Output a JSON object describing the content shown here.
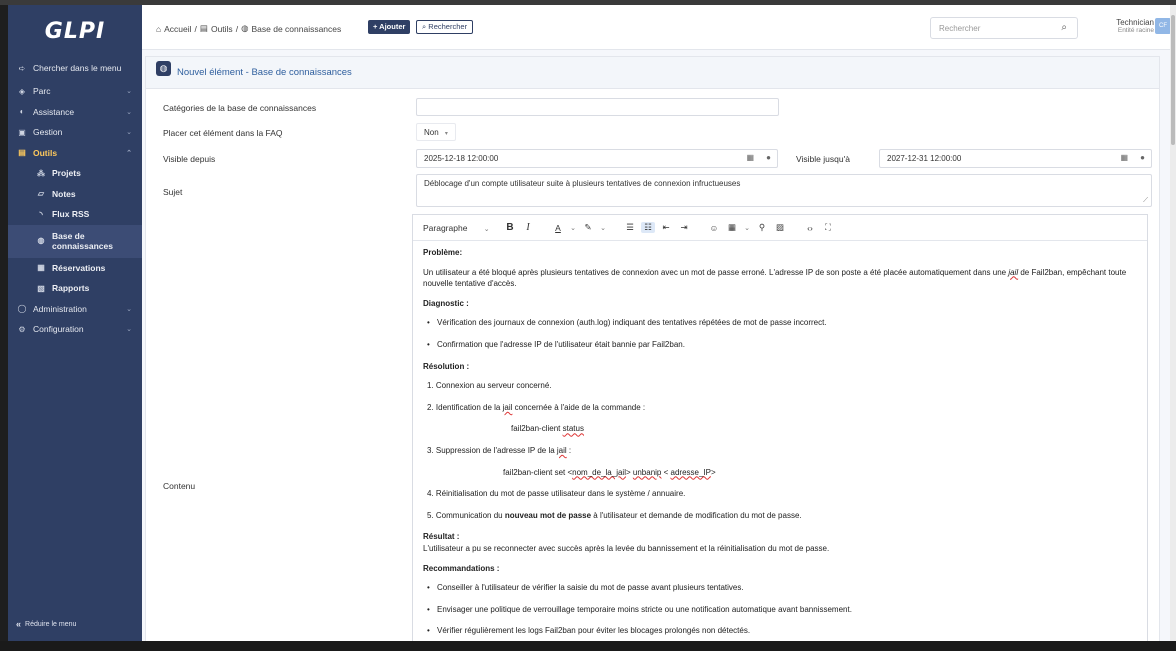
{
  "app": {
    "logo": "GLPI"
  },
  "sidebar": {
    "search_label": "Chercher dans le menu",
    "items": [
      {
        "label": "Parc",
        "icon": "cube-icon"
      },
      {
        "label": "Assistance",
        "icon": "headset-icon"
      },
      {
        "label": "Gestion",
        "icon": "wallet-icon"
      },
      {
        "label": "Outils",
        "icon": "briefcase-icon"
      },
      {
        "label": "Administration",
        "icon": "shield-icon"
      },
      {
        "label": "Configuration",
        "icon": "gear-icon"
      }
    ],
    "sub_items": [
      {
        "label": "Projets"
      },
      {
        "label": "Notes"
      },
      {
        "label": "Flux RSS"
      },
      {
        "label": "Base de connaissances"
      },
      {
        "label": "Réservations"
      },
      {
        "label": "Rapports"
      }
    ],
    "collapse_label": "Réduire le menu"
  },
  "header": {
    "breadcrumb": [
      "Accueil",
      "Outils",
      "Base de connaissances"
    ],
    "add_label": "+ Ajouter",
    "search_label": "Rechercher",
    "global_search_placeholder": "Rechercher",
    "user_name": "Technician",
    "user_entity": "Entité racine",
    "avatar_initials": "CF"
  },
  "form": {
    "title": "Nouvel élément - Base de connaissances",
    "categories_label": "Catégories de la base de connaissances",
    "categories_value": "",
    "faq_label": "Placer cet élément dans la FAQ",
    "faq_value": "Non",
    "visible_from_label": "Visible depuis",
    "visible_from_value": "2025-12-18 12:00:00",
    "visible_until_label": "Visible jusqu'à",
    "visible_until_value": "2027-12-31 12:00:00",
    "subject_label": "Sujet",
    "subject_value": "Déblocage d'un compte utilisateur suite à plusieurs tentatives de connexion infructueuses",
    "content_label": "Contenu"
  },
  "editor": {
    "block_format": "Paragraphe",
    "content": {
      "h_probleme": "Problème:",
      "p_probleme_a": "Un utilisateur a été bloqué après plusieurs tentatives de connexion avec un mot de passe erroné. L'adresse IP de son poste a été placée automatiquement dans une ",
      "p_probleme_jail": "jail",
      "p_probleme_b": " de Fail2ban, empêchant toute nouvelle tentative d'accès.",
      "h_diagnostic": "Diagnostic :",
      "diag_1": "Vérification des journaux de connexion (auth.log) indiquant des tentatives répétées de mot de passe incorrect.",
      "diag_2": "Confirmation que l'adresse IP de l'utilisateur était bannie par Fail2ban.",
      "h_resolution": "Résolution :",
      "res_1": "1. Connexion au serveur concerné.",
      "res_2_a": "2. Identification de la ",
      "res_2_jail": "jail",
      "res_2_b": " concernée à l'aide de la commande :",
      "cmd_1_a": "fail2ban-client ",
      "cmd_1_b": "status",
      "res_3_a": "3. Suppression de l'adresse IP de la ",
      "res_3_jail": "jail",
      "res_3_b": " :",
      "cmd_2_a": "fail2ban-client set <",
      "cmd_2_b": "nom_de_la_jail",
      "cmd_2_c": "> ",
      "cmd_2_d": "unbanip",
      "cmd_2_e": " < ",
      "cmd_2_f": "adresse_IP",
      "cmd_2_g": ">",
      "res_4": "4. Réinitialisation du mot de passe utilisateur dans le système / annuaire.",
      "res_5_a": "5. Communication du ",
      "res_5_b": "nouveau mot de passe",
      "res_5_c": " à l'utilisateur et demande de modification du mot de passe.",
      "h_resultat": "Résultat :",
      "p_resultat": "L'utilisateur a pu se reconnecter avec succès après la levée du bannissement et la réinitialisation du mot de passe.",
      "h_recommandations": "Recommandations :",
      "rec_1": "Conseiller à l'utilisateur de vérifier la saisie du mot de passe avant plusieurs tentatives.",
      "rec_2": "Envisager une politique de verrouillage temporaire moins stricte ou une notification automatique avant bannissement.",
      "rec_3": "Vérifier régulièrement les logs Fail2ban pour éviter les blocages prolongés non détectés."
    }
  }
}
